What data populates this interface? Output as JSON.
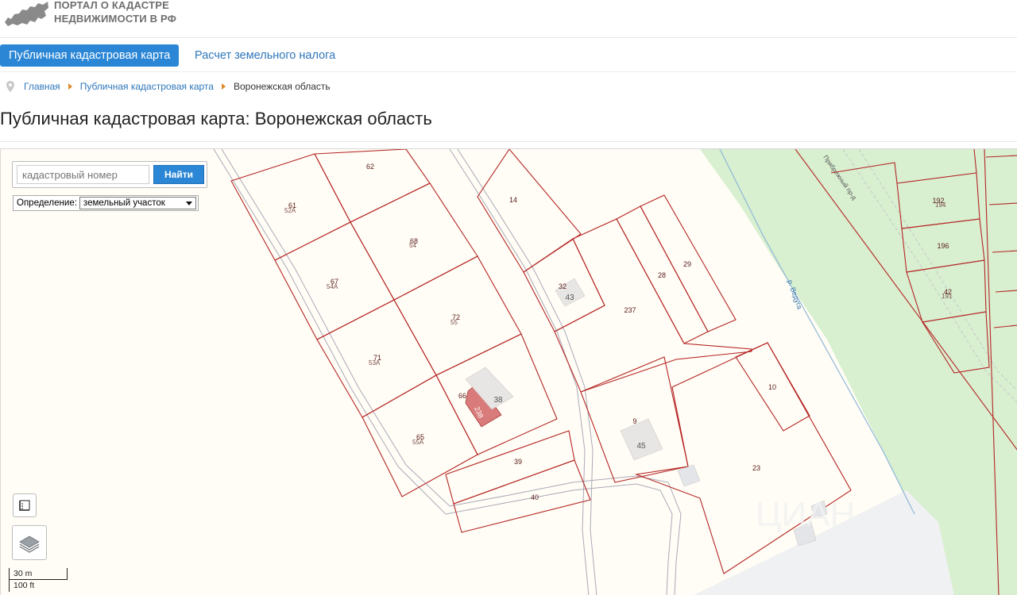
{
  "header": {
    "logo_line1": "ПОРТАЛ О КАДАСТРЕ",
    "logo_line2": "НЕДВИЖИМОСТИ В РФ"
  },
  "nav": {
    "tabs": [
      {
        "label": "Публичная кадастровая карта",
        "active": true
      },
      {
        "label": "Расчет земельного налога",
        "active": false
      }
    ]
  },
  "breadcrumb": {
    "items": [
      "Главная",
      "Публичная кадастровая карта"
    ],
    "current": "Воронежская область"
  },
  "page_title": "Публичная кадастровая карта: Воронежская область",
  "map": {
    "search": {
      "placeholder": "кадастровый номер",
      "button_label": "Найти"
    },
    "definition": {
      "label": "Определение:",
      "selected": "земельный участок"
    },
    "scale": {
      "metric": "30 m",
      "imperial": "100 ft"
    },
    "river_label": "р. Ведуга",
    "road_label": "Прибрежный пр-д",
    "parcels": [
      "62",
      "61",
      "14",
      "68",
      "67",
      "32",
      "43",
      "237",
      "28",
      "29",
      "72",
      "71",
      "38",
      "66",
      "238",
      "10",
      "9",
      "45",
      "65",
      "39",
      "40",
      "23",
      "192",
      "196",
      "42"
    ],
    "parcel_sublabels": [
      "52А",
      "54А",
      "53А",
      "55А",
      "54",
      "55",
      "194",
      "191"
    ],
    "watermark": "ЦИАН"
  },
  "colors": {
    "accent": "#2b87d6",
    "link": "#2f77b9",
    "parcel_border": "#b52525",
    "selected_parcel": "#d97b7b",
    "map_background": "#fffdf5",
    "green_zone": "#d8efd0"
  }
}
